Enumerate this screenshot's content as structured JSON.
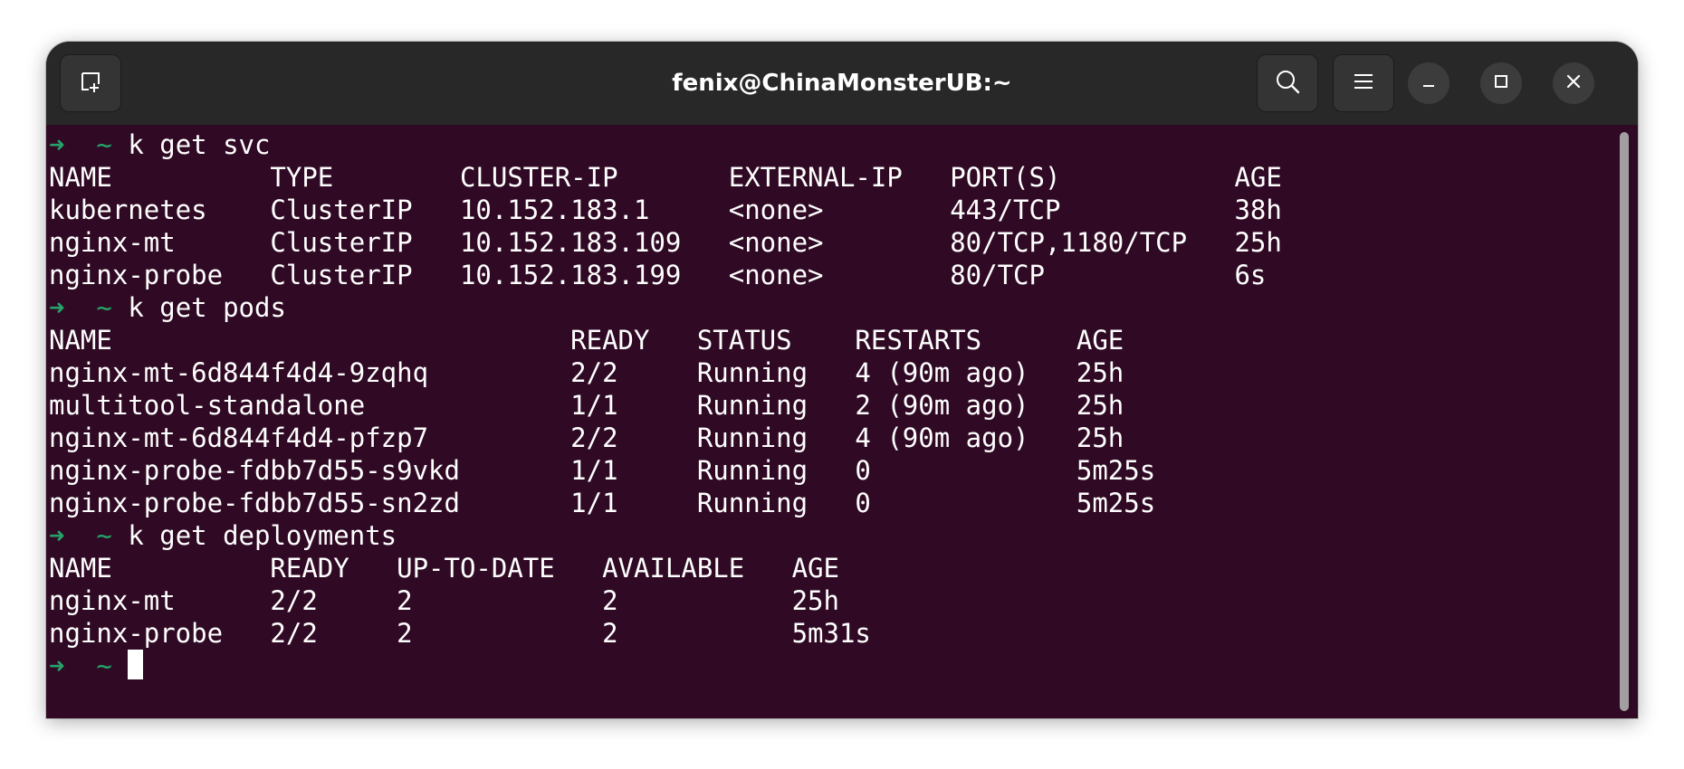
{
  "window": {
    "title": "fenix@ChinaMonsterUB:~"
  },
  "icons": {
    "new_tab": "new-tab-icon",
    "search": "search-icon",
    "menu": "hamburger-menu-icon",
    "minimize": "minimize-icon",
    "maximize": "maximize-icon",
    "close": "close-icon"
  },
  "colors": {
    "titlebar_bg": "#282828",
    "terminal_bg": "#300a24",
    "prompt_green": "#26a269",
    "text": "#ffffff"
  },
  "prompt": {
    "arrow": "➜",
    "dir": "~"
  },
  "lines": [
    {
      "type": "prompt",
      "cmd": "k get svc"
    },
    {
      "type": "out",
      "text": "NAME          TYPE        CLUSTER-IP       EXTERNAL-IP   PORT(S)           AGE"
    },
    {
      "type": "out",
      "text": "kubernetes    ClusterIP   10.152.183.1     <none>        443/TCP           38h"
    },
    {
      "type": "out",
      "text": "nginx-mt      ClusterIP   10.152.183.109   <none>        80/TCP,1180/TCP   25h"
    },
    {
      "type": "out",
      "text": "nginx-probe   ClusterIP   10.152.183.199   <none>        80/TCP            6s"
    },
    {
      "type": "prompt",
      "cmd": "k get pods"
    },
    {
      "type": "out",
      "text": "NAME                             READY   STATUS    RESTARTS      AGE"
    },
    {
      "type": "out",
      "text": "nginx-mt-6d844f4d4-9zqhq         2/2     Running   4 (90m ago)   25h"
    },
    {
      "type": "out",
      "text": "multitool-standalone             1/1     Running   2 (90m ago)   25h"
    },
    {
      "type": "out",
      "text": "nginx-mt-6d844f4d4-pfzp7         2/2     Running   4 (90m ago)   25h"
    },
    {
      "type": "out",
      "text": "nginx-probe-fdbb7d55-s9vkd       1/1     Running   0             5m25s"
    },
    {
      "type": "out",
      "text": "nginx-probe-fdbb7d55-sn2zd       1/1     Running   0             5m25s"
    },
    {
      "type": "prompt",
      "cmd": "k get deployments"
    },
    {
      "type": "out",
      "text": "NAME          READY   UP-TO-DATE   AVAILABLE   AGE"
    },
    {
      "type": "out",
      "text": "nginx-mt      2/2     2            2           25h"
    },
    {
      "type": "out",
      "text": "nginx-probe   2/2     2            2           5m31s"
    },
    {
      "type": "prompt",
      "cmd": "",
      "cursor": true
    }
  ]
}
